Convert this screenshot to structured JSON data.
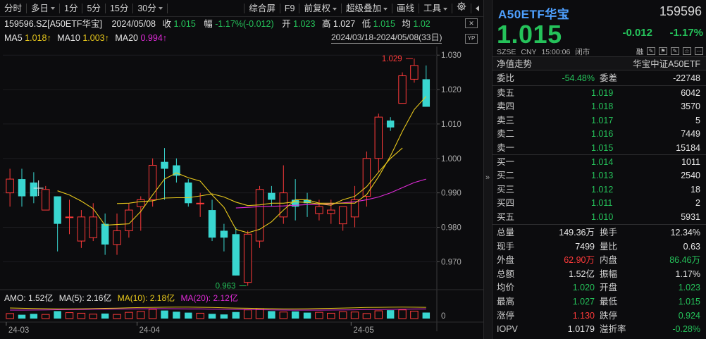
{
  "toolbar": {
    "periods": [
      "分时",
      "多日",
      "1分",
      "5分",
      "15分",
      "30分"
    ],
    "right_items": [
      "综合屏",
      "F9",
      "前复权",
      "超级叠加",
      "画线",
      "工具"
    ],
    "gear_icon": "gear-icon"
  },
  "header": {
    "symbol": "159596.SZ[A50ETF华宝]",
    "date": "2024/05/08",
    "close_label": "收",
    "close": "1.015",
    "amp_label": "幅",
    "amp": "-1.17%(-0.012)",
    "open_label": "开",
    "open": "1.023",
    "high_label": "高",
    "high": "1.027",
    "low_label": "低",
    "low": "1.015",
    "avg_label": "均",
    "avg": "1.02"
  },
  "ma": {
    "ma5_label": "MA5",
    "ma5": "1.018↑",
    "ma10_label": "MA10",
    "ma10": "1.003↑",
    "ma20_label": "MA20",
    "ma20": "0.994↑",
    "range": "2024/03/18-2024/05/08(33日)"
  },
  "colors": {
    "up": "#ff3a3a",
    "down": "#25c25a",
    "flat_candle": "#39d6d0",
    "ma5": "#e8c81c",
    "ma10": "#e8c81c",
    "ma20": "#e02ad8",
    "accent_title": "#4ea0ff"
  },
  "volume": {
    "amo_label": "AMO: 1.52亿",
    "ma5_label": "MA(5): 2.16亿",
    "ma10_label": "MA(10): 2.18亿",
    "ma20_label": "MA(20): 2.12亿",
    "zero_label": "0"
  },
  "chart_data": {
    "type": "candlestick",
    "y_ticks": [
      "1.030",
      "1.020",
      "1.010",
      "1.000",
      "0.990",
      "0.980",
      "0.970"
    ],
    "ylim": [
      0.9625,
      1.0325
    ],
    "x_ticks": [
      "24-03",
      "24-04",
      "24-05"
    ],
    "x_tick_index": [
      0,
      11,
      29
    ],
    "high_marker": "1.029",
    "low_marker": "0.963",
    "candles": [
      {
        "o": 0.99,
        "c": 0.994,
        "h": 0.997,
        "l": 0.986
      },
      {
        "o": 0.994,
        "c": 0.989,
        "h": 0.997,
        "l": 0.986
      },
      {
        "o": 0.993,
        "c": 0.989,
        "h": 0.996,
        "l": 0.987
      },
      {
        "o": 0.991,
        "c": 0.985,
        "h": 0.992,
        "l": 0.985
      },
      {
        "o": 0.981,
        "c": 0.989,
        "h": 0.989,
        "l": 0.973
      },
      {
        "o": 0.983,
        "c": 0.983,
        "h": 0.988,
        "l": 0.978
      },
      {
        "o": 0.976,
        "c": 0.983,
        "h": 0.985,
        "l": 0.974
      },
      {
        "o": 0.983,
        "c": 0.977,
        "h": 0.987,
        "l": 0.976
      },
      {
        "o": 0.975,
        "c": 0.981,
        "h": 0.984,
        "l": 0.972
      },
      {
        "o": 0.975,
        "c": 0.979,
        "h": 0.984,
        "l": 0.972
      },
      {
        "o": 0.979,
        "c": 0.985,
        "h": 0.987,
        "l": 0.977
      },
      {
        "o": 0.986,
        "c": 0.988,
        "h": 0.989,
        "l": 0.979
      },
      {
        "o": 0.988,
        "c": 0.998,
        "h": 1.0,
        "l": 0.986
      },
      {
        "o": 0.997,
        "c": 0.999,
        "h": 1.003,
        "l": 0.988
      },
      {
        "o": 0.998,
        "c": 0.995,
        "h": 1.0,
        "l": 0.993
      },
      {
        "o": 0.993,
        "c": 0.987,
        "h": 0.994,
        "l": 0.986
      },
      {
        "o": 0.987,
        "c": 0.987,
        "h": 0.99,
        "l": 0.983
      },
      {
        "o": 0.985,
        "c": 0.977,
        "h": 0.988,
        "l": 0.976
      },
      {
        "o": 0.977,
        "c": 0.979,
        "h": 0.981,
        "l": 0.973
      },
      {
        "o": 0.978,
        "c": 0.966,
        "h": 0.98,
        "l": 0.966
      },
      {
        "o": 0.964,
        "c": 0.978,
        "h": 0.979,
        "l": 0.963
      },
      {
        "o": 0.976,
        "c": 0.991,
        "h": 0.992,
        "l": 0.974
      },
      {
        "o": 0.988,
        "c": 0.99,
        "h": 0.992,
        "l": 0.986
      },
      {
        "o": 0.99,
        "c": 0.983,
        "h": 0.998,
        "l": 0.981
      },
      {
        "o": 0.986,
        "c": 0.988,
        "h": 0.994,
        "l": 0.982
      },
      {
        "o": 0.988,
        "c": 0.987,
        "h": 0.99,
        "l": 0.983
      },
      {
        "o": 0.986,
        "c": 0.984,
        "h": 0.988,
        "l": 0.982
      },
      {
        "o": 0.985,
        "c": 0.984,
        "h": 0.988,
        "l": 0.981
      },
      {
        "o": 0.981,
        "c": 0.986,
        "h": 0.986,
        "l": 0.979
      },
      {
        "o": 0.983,
        "c": 0.988,
        "h": 0.992,
        "l": 0.98
      },
      {
        "o": 0.989,
        "c": 1.0,
        "h": 1.002,
        "l": 0.986
      },
      {
        "o": 1.0,
        "c": 1.012,
        "h": 1.013,
        "l": 0.996
      },
      {
        "o": 1.009,
        "c": 1.011,
        "h": 1.012,
        "l": 1.008
      },
      {
        "o": 1.016,
        "c": 1.024,
        "h": 1.025,
        "l": 1.016
      },
      {
        "o": 1.023,
        "c": 1.027,
        "h": 1.029,
        "l": 1.022
      },
      {
        "o": 1.023,
        "c": 1.015,
        "h": 1.027,
        "l": 1.015
      }
    ],
    "candle_style": [
      "up",
      "down",
      "flat",
      "up",
      "down",
      "up",
      "up",
      "up",
      "down",
      "up",
      "up",
      "up",
      "up",
      "flat",
      "flat",
      "down",
      "up",
      "down",
      "down",
      "flat",
      "up",
      "up",
      "down",
      "up",
      "down",
      "flat",
      "up",
      "up",
      "up",
      "up",
      "up",
      "up",
      "down",
      "up",
      "up",
      "down"
    ],
    "ma5": [
      null,
      null,
      null,
      null,
      0.9906,
      0.9894,
      0.9876,
      0.9854,
      0.9806,
      0.9808,
      0.981,
      0.9846,
      0.9894,
      0.994,
      0.9958,
      0.9944,
      0.9934,
      0.9894,
      0.9858,
      0.9794,
      0.9784,
      0.9794,
      0.9816,
      0.985,
      0.988,
      0.988,
      0.987,
      0.987,
      0.987,
      0.987,
      0.9895,
      0.9947,
      1.0007,
      1.0079,
      1.0142,
      1.018
    ],
    "ma10": [
      null,
      null,
      null,
      null,
      null,
      null,
      null,
      null,
      null,
      0.9869,
      0.987,
      0.9875,
      0.9877,
      0.9885,
      0.9886,
      0.9886,
      0.9891,
      0.9897,
      0.9888,
      0.9873,
      0.9863,
      0.9865,
      0.987,
      0.987,
      0.9874,
      0.9872,
      0.9868,
      0.9864,
      0.988,
      0.989,
      0.9918,
      0.996,
      1.0,
      1.003
    ],
    "ma20": [
      null,
      null,
      null,
      null,
      null,
      null,
      null,
      null,
      null,
      null,
      null,
      null,
      null,
      null,
      null,
      null,
      null,
      null,
      null,
      0.9856,
      0.9858,
      0.986,
      0.9861,
      0.9862,
      0.9864,
      0.9866,
      0.9867,
      0.9868,
      0.9871,
      0.9874,
      0.988,
      0.9888,
      0.99,
      0.9915,
      0.993,
      0.994
    ],
    "volumes": [
      1.2,
      0.8,
      1.1,
      0.9,
      2.0,
      1.5,
      1.3,
      1.0,
      1.2,
      0.9,
      1.6,
      1.9,
      2.6,
      2.2,
      1.8,
      1.5,
      1.3,
      1.1,
      0.9,
      1.7,
      2.4,
      2.8,
      2.0,
      1.7,
      1.9,
      1.5,
      1.6,
      1.3,
      1.8,
      1.7,
      1.2,
      2.1,
      2.3,
      2.4,
      2.0,
      1.52
    ]
  },
  "quote": {
    "name": "A50ETF华宝",
    "code": "159596",
    "price": "1.015",
    "change": "-0.012",
    "change_pct": "-1.17%",
    "exchange": "SZSE",
    "currency": "CNY",
    "time": "15:00:06",
    "status": "闭市",
    "margin_icon": "融",
    "nav_label": "净值走势",
    "nav_index": "华宝中证A50ETF"
  },
  "order_summary": {
    "weibi_label": "委比",
    "weibi": "-54.48%",
    "weicha_label": "委差",
    "weicha": "-22748"
  },
  "asks": [
    {
      "label": "卖五",
      "price": "1.019",
      "vol": "6042"
    },
    {
      "label": "卖四",
      "price": "1.018",
      "vol": "3570"
    },
    {
      "label": "卖三",
      "price": "1.017",
      "vol": "5"
    },
    {
      "label": "卖二",
      "price": "1.016",
      "vol": "7449"
    },
    {
      "label": "卖一",
      "price": "1.015",
      "vol": "15184"
    }
  ],
  "bids": [
    {
      "label": "买一",
      "price": "1.014",
      "vol": "1011"
    },
    {
      "label": "买二",
      "price": "1.013",
      "vol": "2540"
    },
    {
      "label": "买三",
      "price": "1.012",
      "vol": "18"
    },
    {
      "label": "买四",
      "price": "1.011",
      "vol": "2"
    },
    {
      "label": "买五",
      "price": "1.010",
      "vol": "5931"
    }
  ],
  "stats": [
    {
      "l1": "总量",
      "v1": "149.36万",
      "c1": "white",
      "l2": "换手",
      "v2": "12.34%",
      "c2": "white"
    },
    {
      "l1": "现手",
      "v1": "7499",
      "c1": "white",
      "l2": "量比",
      "v2": "0.63",
      "c2": "white"
    },
    {
      "l1": "外盘",
      "v1": "62.90万",
      "c1": "red",
      "l2": "内盘",
      "v2": "86.46万",
      "c2": "green"
    },
    {
      "l1": "总额",
      "v1": "1.52亿",
      "c1": "white",
      "l2": "振幅",
      "v2": "1.17%",
      "c2": "white"
    },
    {
      "l1": "均价",
      "v1": "1.020",
      "c1": "green",
      "l2": "开盘",
      "v2": "1.023",
      "c2": "green"
    },
    {
      "l1": "最高",
      "v1": "1.027",
      "c1": "green",
      "l2": "最低",
      "v2": "1.015",
      "c2": "green"
    },
    {
      "l1": "涨停",
      "v1": "1.130",
      "c1": "red",
      "l2": "跌停",
      "v2": "0.924",
      "c2": "green"
    },
    {
      "l1": "IOPV",
      "v1": "1.0179",
      "c1": "white",
      "l2": "溢折率",
      "v2": "-0.28%",
      "c2": "green"
    }
  ]
}
